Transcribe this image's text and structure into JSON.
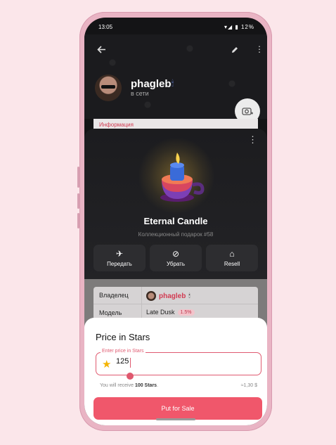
{
  "status_bar": {
    "time": "13:05",
    "battery": "12%",
    "icons": "▾◢ ▮"
  },
  "header": {
    "back_icon": "arrow-left-icon",
    "edit_icon": "pencil-icon",
    "menu_icon": "more-vertical-icon"
  },
  "profile": {
    "name": "phagleb",
    "status": "в сети",
    "camera_icon": "camera-add-icon"
  },
  "info_section": {
    "label": "Информация"
  },
  "gift": {
    "name": "Eternal Candle",
    "subtitle": "Коллекционный подарок #58",
    "actions": [
      {
        "label": "Передать",
        "icon": "transfer-icon",
        "glyph": "✈"
      },
      {
        "label": "Убрать",
        "icon": "hide-icon",
        "glyph": "⊘"
      },
      {
        "label": "Resell",
        "icon": "tag-icon",
        "glyph": "⌂"
      }
    ]
  },
  "details": {
    "rows": [
      {
        "key": "Владелец",
        "value": "phagleb"
      },
      {
        "key": "Модель",
        "value": "Late Dusk",
        "badge": "1.5%"
      }
    ]
  },
  "price_dialog": {
    "title": "Price in Stars",
    "field_label": "Enter price in Stars",
    "field_value": "125",
    "receive_prefix": "You will receive ",
    "receive_amount": "100 Stars",
    "receive_suffix": ".",
    "equivalent": "≈1,30 $",
    "slider_fraction": 0.1,
    "cta_label": "Put for Sale"
  },
  "colors": {
    "accent": "#f0576b",
    "accent_border": "#e05a70",
    "star": "#f4b400",
    "page_bg": "#fbe6ea",
    "phone_frame": "#e9b4c4"
  }
}
